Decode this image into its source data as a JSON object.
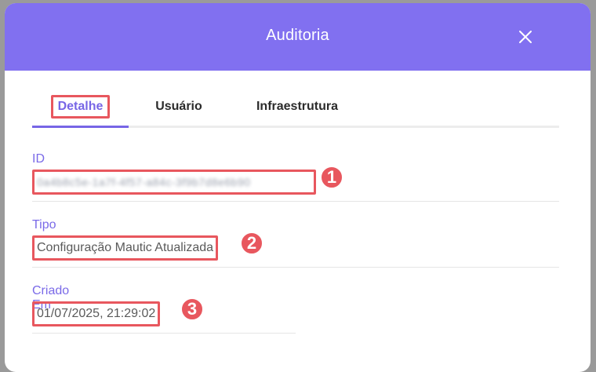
{
  "modal": {
    "title": "Auditoria"
  },
  "tabs": [
    {
      "label": "Detalhe",
      "active": true
    },
    {
      "label": "Usuário",
      "active": false
    },
    {
      "label": "Infraestrutura",
      "active": false
    }
  ],
  "fields": {
    "id": {
      "label": "ID",
      "value": "0a4b8c5e-1a7f-4f57-a84c-3f9b7d8e6b90"
    },
    "tipo": {
      "label": "Tipo",
      "value": "Configuração Mautic Atualizada"
    },
    "criado": {
      "label": "Criado Em",
      "value": "01/07/2025, 21:29:02"
    }
  },
  "annotations": [
    "1",
    "2",
    "3"
  ],
  "colors": {
    "accent": "#7766e6",
    "header": "#8170f0",
    "highlight": "#e8575e"
  },
  "icons": {
    "close": "close-icon"
  }
}
